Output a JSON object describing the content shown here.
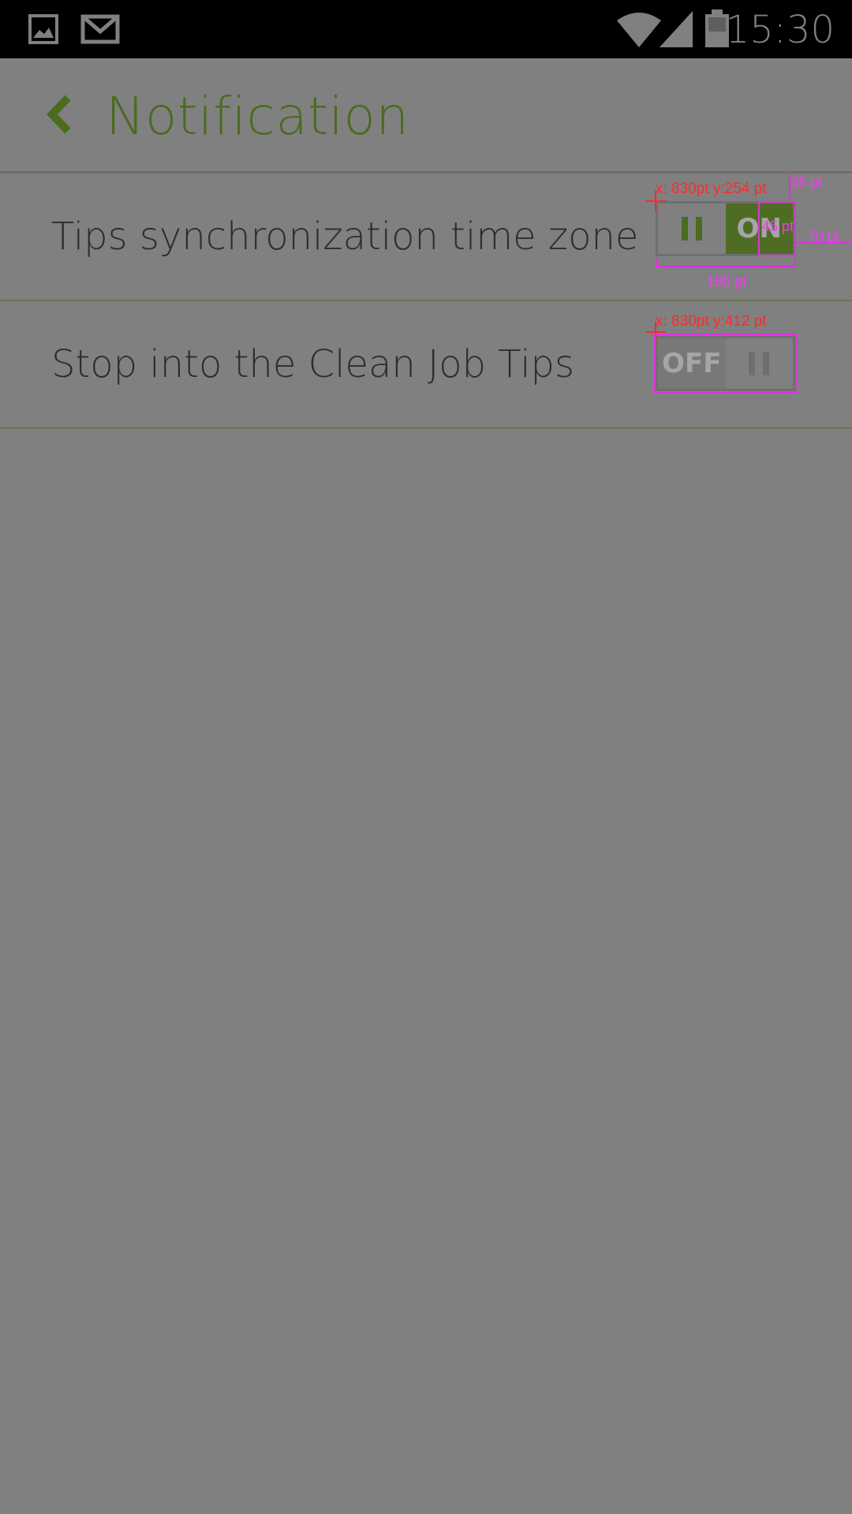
{
  "status_bar": {
    "time": "15:30",
    "icons": [
      "gallery-icon",
      "gmail-icon",
      "wifi-icon",
      "signal-icon",
      "battery-icon"
    ]
  },
  "header": {
    "back_icon": "chevron-left-icon",
    "title": "Notification"
  },
  "settings": [
    {
      "label": "Tips synchronization time zone",
      "toggle_state": "on",
      "toggle_text": "ON"
    },
    {
      "label": "Stop into the Clean Job Tips",
      "toggle_state": "off",
      "toggle_text": "OFF"
    }
  ],
  "annotations": {
    "toggle1_position": "x: 830pt y:254 pt",
    "toggle2_position": "x: 830pt y:412 pt",
    "width_label": "180 pt",
    "height_label": "70 pt",
    "margin_label": "35 pt",
    "thumb_label": "45 pt"
  },
  "colors": {
    "accent_green": "#4b6b1f",
    "background": "#808080",
    "status_bar": "#000000",
    "annotation_red": "#ff2a2a",
    "annotation_magenta": "#e030e0"
  }
}
